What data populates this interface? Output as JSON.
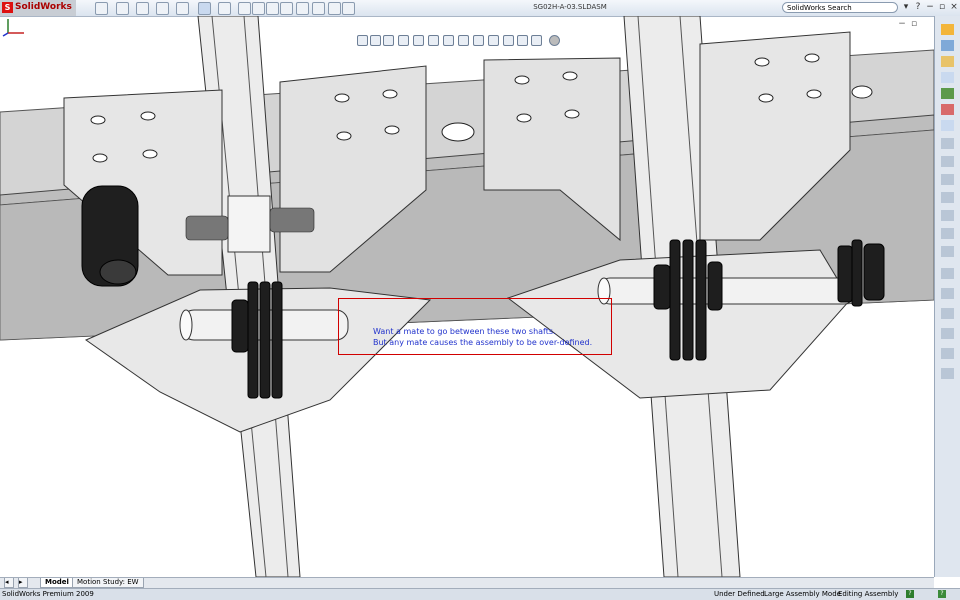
{
  "app": {
    "brand": "SolidWorks",
    "brand_icon": "solidworks-logo-icon",
    "brand_color": "#cc1111"
  },
  "titlebar": {
    "document_title": "SG02H-A-03.SLDASM",
    "search_placeholder": "SolidWorks Search",
    "tool_icons": [
      "new-icon",
      "open-icon",
      "save-icon",
      "print-icon",
      "undo-icon",
      "select-icon",
      "rebuild-icon",
      "options-icon",
      "help-icon"
    ]
  },
  "viewport": {
    "note": {
      "line1": "Want a mate to go between these two shafts.",
      "line2": "But any mate causes the assembly to be over-defined.",
      "text_color": "#2233cc",
      "border_color": "#d10000"
    },
    "heads_up_icons": [
      "zoom-to-fit-icon",
      "zoom-area-icon",
      "previous-view-icon",
      "section-view-icon",
      "view-orientation-icon",
      "display-style-icon",
      "hide-show-icon",
      "edit-appearance-icon",
      "apply-scene-icon",
      "view-settings-icon"
    ]
  },
  "tabs": {
    "model": "Model",
    "motion": "Motion Study: EW"
  },
  "status": {
    "product": "SolidWorks Premium 2009",
    "state": "Under Defined",
    "mode": "Large Assembly Mode",
    "editing": "Editing Assembly"
  }
}
